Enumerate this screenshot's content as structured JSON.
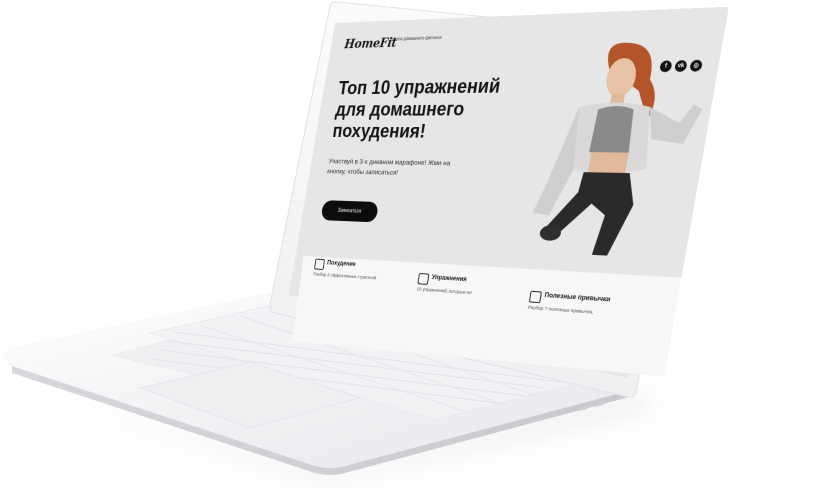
{
  "brand": {
    "logo": "HomeFit",
    "tagline": "Школа домашнего фитнеса"
  },
  "socials": [
    {
      "icon": "facebook-icon",
      "glyph": "f"
    },
    {
      "icon": "vk-icon",
      "glyph": "vk"
    },
    {
      "icon": "instagram-icon",
      "glyph": "◎"
    }
  ],
  "hero": {
    "headline": "Топ 10 упражнений для домашнего похудения!",
    "subtext": "Участвуй в 3-х дневном марафоне! Жми на кнопку, чтобы записаться!",
    "cta_label": "Записаться"
  },
  "features": [
    {
      "icon": "scale-icon",
      "title": "Похудение",
      "text": "Разбор 3 эффективных стратегий"
    },
    {
      "icon": "dumbbell-icon",
      "title": "Упражнения",
      "text": "10 упражнений, которые не"
    },
    {
      "icon": "bottle-icon",
      "title": "Полезные привычки",
      "text": "Разбор 7 полезных привычек,"
    }
  ],
  "colors": {
    "background": "#ffffff",
    "laptop_body": "#f4f4f6",
    "screen_bg": "#e5e6e6",
    "features_bg": "#f7f7f7",
    "cta_bg": "#0c0c0c"
  }
}
